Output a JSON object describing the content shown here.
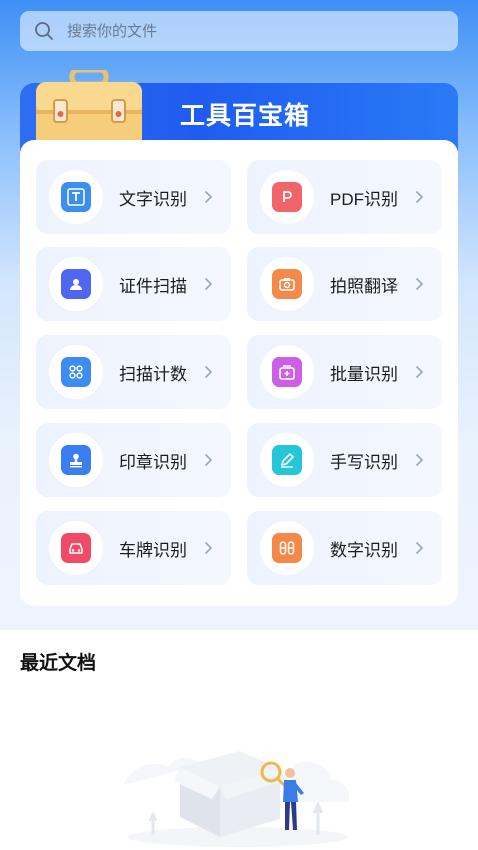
{
  "search": {
    "placeholder": "搜索你的文件"
  },
  "banner": {
    "title": "工具百宝箱"
  },
  "tools": [
    {
      "label": "文字识别",
      "icon": "text-recognition-icon",
      "color": "#3b8ff0"
    },
    {
      "label": "PDF识别",
      "icon": "pdf-icon",
      "color": "#f0646a"
    },
    {
      "label": "证件扫描",
      "icon": "id-card-icon",
      "color": "#4f67f0"
    },
    {
      "label": "拍照翻译",
      "icon": "camera-icon",
      "color": "#f3894a"
    },
    {
      "label": "扫描计数",
      "icon": "count-icon",
      "color": "#3d8cf0"
    },
    {
      "label": "批量识别",
      "icon": "batch-icon",
      "color": "#cc5fe6"
    },
    {
      "label": "印章识别",
      "icon": "stamp-icon",
      "color": "#3b7ef0"
    },
    {
      "label": "手写识别",
      "icon": "handwriting-icon",
      "color": "#25c6d8"
    },
    {
      "label": "车牌识别",
      "icon": "car-icon",
      "color": "#f04a66"
    },
    {
      "label": "数字识别",
      "icon": "digits-icon",
      "color": "#f3884a"
    }
  ],
  "recent": {
    "title": "最近文档"
  }
}
